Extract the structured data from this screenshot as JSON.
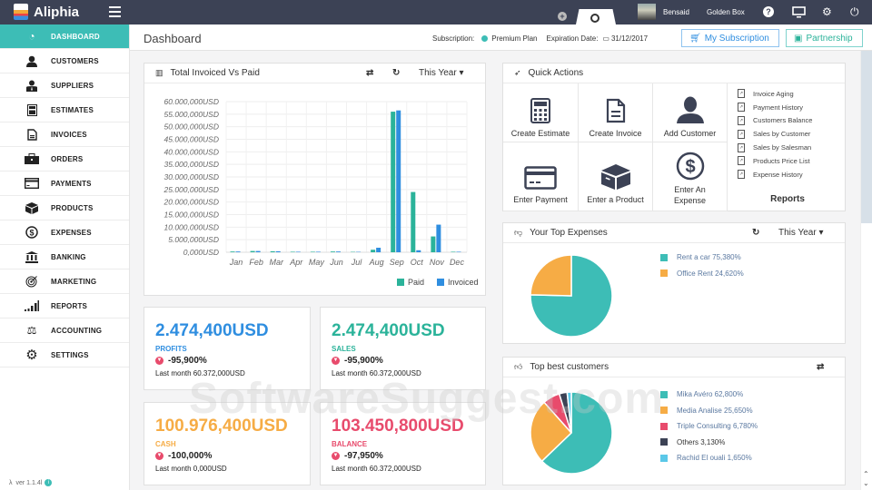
{
  "app": {
    "name": "Aliphia",
    "version": "ver 1.1.4l"
  },
  "topbar": {
    "user_name": "Bensaid",
    "company": "Golden Box",
    "icons": [
      "help-icon",
      "monitor-icon",
      "gear-icon",
      "power-icon"
    ]
  },
  "sidebar": {
    "items": [
      {
        "label": "DASHBOARD",
        "icon": "dashboard-icon",
        "active": true
      },
      {
        "label": "CUSTOMERS",
        "icon": "user-icon"
      },
      {
        "label": "SUPPLIERS",
        "icon": "supplier-icon"
      },
      {
        "label": "ESTIMATES",
        "icon": "calculator-icon"
      },
      {
        "label": "INVOICES",
        "icon": "document-icon"
      },
      {
        "label": "ORDERS",
        "icon": "briefcase-icon"
      },
      {
        "label": "PAYMENTS",
        "icon": "credit-card-icon"
      },
      {
        "label": "PRODUCTS",
        "icon": "box-icon"
      },
      {
        "label": "EXPENSES",
        "icon": "dollar-circle-icon"
      },
      {
        "label": "BANKING",
        "icon": "bank-icon"
      },
      {
        "label": "MARKETING",
        "icon": "target-icon"
      },
      {
        "label": "REPORTS",
        "icon": "signal-bars-icon"
      },
      {
        "label": "ACCOUNTING",
        "icon": "scale-icon"
      },
      {
        "label": "SETTINGS",
        "icon": "gear-icon"
      }
    ]
  },
  "header": {
    "title": "Dashboard",
    "subscription_label": "Subscription:",
    "plan": "Premium Plan",
    "expiration_label": "Expiration Date:",
    "expiration_date": "31/12/2017",
    "my_subscription": "My Subscription",
    "partnership": "Partnership"
  },
  "invoiced_panel": {
    "title": "Total Invoiced Vs Paid",
    "period": "This Year"
  },
  "kpis": [
    {
      "value": "2.474,400USD",
      "label": "PROFITS",
      "change": "-95,900%",
      "last": "Last month 60.372,000USD",
      "color": "#2f8ee0"
    },
    {
      "value": "2.474,400USD",
      "label": "SALES",
      "change": "-95,900%",
      "last": "Last month 60.372,000USD",
      "color": "#2bb39a"
    },
    {
      "value": "100.976,400USD",
      "label": "CASH",
      "change": "-100,000%",
      "last": "Last month 0,000USD",
      "color": "#f6ac45"
    },
    {
      "value": "103.450,800USD",
      "label": "BALANCE",
      "change": "-97,950%",
      "last": "Last month 60.372,000USD",
      "color": "#e84b6c"
    }
  ],
  "quick_actions": {
    "title": "Quick Actions",
    "actions": [
      {
        "label": "Create Estimate",
        "icon": "calculator-icon"
      },
      {
        "label": "Create Invoice",
        "icon": "document-icon"
      },
      {
        "label": "Add Customer",
        "icon": "user-icon"
      },
      {
        "label": "Enter Payment",
        "icon": "credit-card-icon"
      },
      {
        "label": "Enter a Product",
        "icon": "box-icon"
      },
      {
        "label": "Enter An Expense",
        "icon": "dollar-circle-icon"
      }
    ],
    "reports": [
      "Invoice Aging",
      "Payment History",
      "Customers Balance",
      "Sales by Customer",
      "Sales by Salesman",
      "Products Price List",
      "Expense History"
    ],
    "reports_label": "Reports"
  },
  "expenses_panel": {
    "title": "Your Top Expenses",
    "period": "This Year"
  },
  "customers_panel": {
    "title": "Top best customers"
  },
  "watermark": "SoftwareSuggest.com",
  "chart_data": [
    {
      "type": "bar",
      "title": "Total Invoiced Vs Paid",
      "categories": [
        "Jan",
        "Feb",
        "Mar",
        "Apr",
        "May",
        "Jun",
        "Jul",
        "Aug",
        "Sep",
        "Oct",
        "Nov",
        "Dec"
      ],
      "series": [
        {
          "name": "Paid",
          "color": "#2bb39a",
          "values": [
            300000,
            500000,
            400000,
            200000,
            200000,
            300000,
            0,
            1000000,
            56000000,
            24000000,
            6300000,
            200000
          ]
        },
        {
          "name": "Invoiced",
          "color": "#2f8ee0",
          "values": [
            300000,
            500000,
            400000,
            200000,
            200000,
            300000,
            0,
            1800000,
            56500000,
            800000,
            11000000,
            200000
          ]
        }
      ],
      "ylim": [
        0,
        60000000
      ],
      "yticks": [
        "0,000USD",
        "5.000,000USD",
        "10.000,000USD",
        "15.000,000USD",
        "20.000,000USD",
        "25.000,000USD",
        "30.000,000USD",
        "35.000,000USD",
        "40.000,000USD",
        "45.000,000USD",
        "50.000,000USD",
        "55.000,000USD",
        "60.000,000USD"
      ],
      "legend": "bottom-right",
      "grid": true
    },
    {
      "type": "pie",
      "title": "Your Top Expenses",
      "slices": [
        {
          "label": "Rent a car",
          "value": 75.38,
          "text": "Rent a car 75,380%",
          "color": "#3dbdb6"
        },
        {
          "label": "Office Rent",
          "value": 24.62,
          "text": "Office Rent 24,620%",
          "color": "#f6ac45"
        }
      ]
    },
    {
      "type": "pie",
      "title": "Top best customers",
      "slices": [
        {
          "label": "Mika Avéro",
          "value": 62.8,
          "text": "Mika Avéro 62,800%",
          "color": "#3dbdb6"
        },
        {
          "label": "Media Analise",
          "value": 25.65,
          "text": "Media Analise 25,650%",
          "color": "#f6ac45"
        },
        {
          "label": "Triple Consulting",
          "value": 6.78,
          "text": "Triple Consulting 6,780%",
          "color": "#e84b6c"
        },
        {
          "label": "Others",
          "value": 3.13,
          "text": "Others 3,130%",
          "color": "#3c4255"
        },
        {
          "label": "Rachid El ouali",
          "value": 1.65,
          "text": "Rachid El ouali 1,650%",
          "color": "#5bc8e8"
        }
      ]
    }
  ]
}
